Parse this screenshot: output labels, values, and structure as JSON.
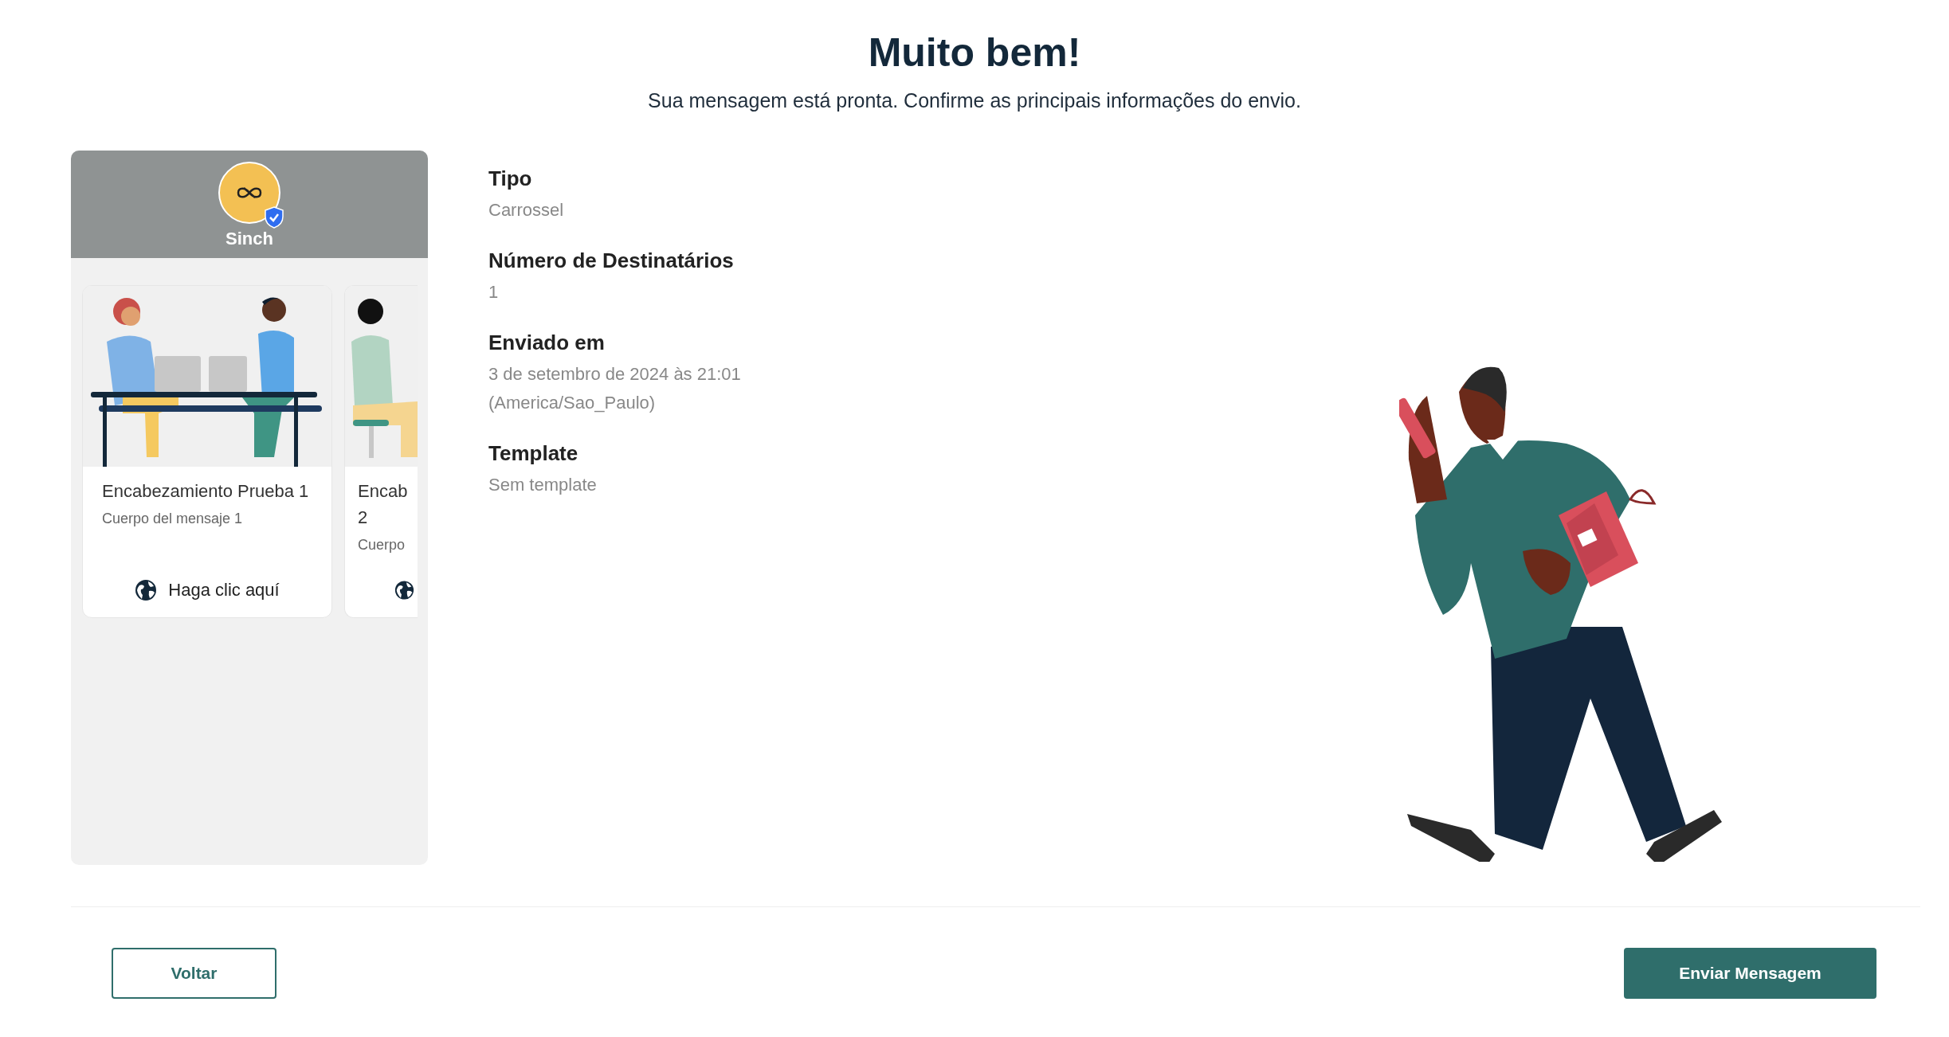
{
  "header": {
    "title": "Muito bem!",
    "subtitle": "Sua mensagem está pronta. Confirme as principais informações do envio."
  },
  "preview": {
    "sender_name": "Sinch",
    "verified": true,
    "cards": [
      {
        "kind": "full",
        "title": "Encabezamiento Prueba 1",
        "body": "Cuerpo del mensaje 1",
        "button_label": "Haga clic aquí"
      },
      {
        "kind": "cut",
        "title": "Encab 2",
        "body": "Cuerpo"
      }
    ]
  },
  "details": [
    {
      "label": "Tipo",
      "value": "Carrossel"
    },
    {
      "label": "Número de Destinatários",
      "value": "1"
    },
    {
      "label": "Enviado em",
      "value": "3 de setembro de 2024 às 21:01 (America/Sao_Paulo)"
    },
    {
      "label": "Template",
      "value": "Sem template"
    }
  ],
  "footer": {
    "back_button": "Voltar",
    "send_button": "Enviar Mensagem"
  }
}
